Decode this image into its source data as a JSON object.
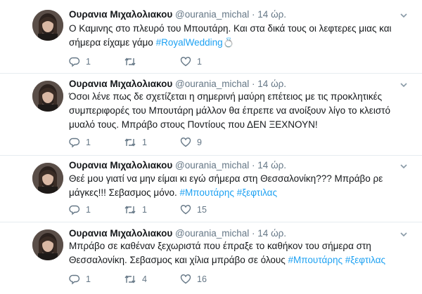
{
  "colors": {
    "link": "#1da1f2",
    "muted": "#657786",
    "text": "#14171a",
    "divider": "#e6ecf0"
  },
  "icons": {
    "reply": "reply-icon",
    "retweet": "retweet-icon",
    "like": "heart-icon",
    "more": "chevron-down-icon"
  },
  "tweets": [
    {
      "name": "Ουρανια Μιχαλολιακου",
      "handle": "@ourania_michal",
      "sep": "·",
      "time": "14 ώρ.",
      "text": "Ο Καμινης στο πλευρό του Μπουτάρη. Και στα δικά τους οι λεφτερες μιας και σήμερα είχαμε γάμο ",
      "hashtags": "#RoyalWedding",
      "emoji": "💍",
      "replies": "1",
      "retweets": "",
      "likes": "1"
    },
    {
      "name": "Ουρανια Μιχαλολιακου",
      "handle": "@ourania_michal",
      "sep": "·",
      "time": "14 ώρ.",
      "text": "Όσοι λένε πως δε σχετίζεται η σημερινή μαύρη επέτειος με τις προκλητικές συμπεριφορές του Μπουτάρη μάλλον θα έπρεπε να ανοίξουν λίγο το κλειστό μυαλό τους. Μπράβο στους Ποντίους που ΔΕΝ ΞΕΧΝΟΥΝ!",
      "hashtags": "",
      "emoji": "",
      "replies": "1",
      "retweets": "1",
      "likes": "9"
    },
    {
      "name": "Ουρανια Μιχαλολιακου",
      "handle": "@ourania_michal",
      "sep": "·",
      "time": "14 ώρ.",
      "text": "Θεέ μου γιατί να μην είμαι κι εγώ σήμερα στη Θεσσαλονίκη??? Μπράβο ρε μάγκες!!! Σεβασμος μόνο.  ",
      "hashtags": "#Μπουτάρης #ξεφτιλας",
      "emoji": "",
      "replies": "1",
      "retweets": "1",
      "likes": "15"
    },
    {
      "name": "Ουρανια Μιχαλολιακου",
      "handle": "@ourania_michal",
      "sep": "·",
      "time": "14 ώρ.",
      "text": "Μπράβο σε καθέναν ξεχωριστά που έπραξε το καθήκον του σήμερα στη Θεσσαλονίκη. Σεβασμος και χίλια μπράβο σε όλους ",
      "hashtags": "#Μπουτάρης #ξεφτιλας",
      "emoji": "",
      "replies": "1",
      "retweets": "4",
      "likes": "16"
    }
  ]
}
